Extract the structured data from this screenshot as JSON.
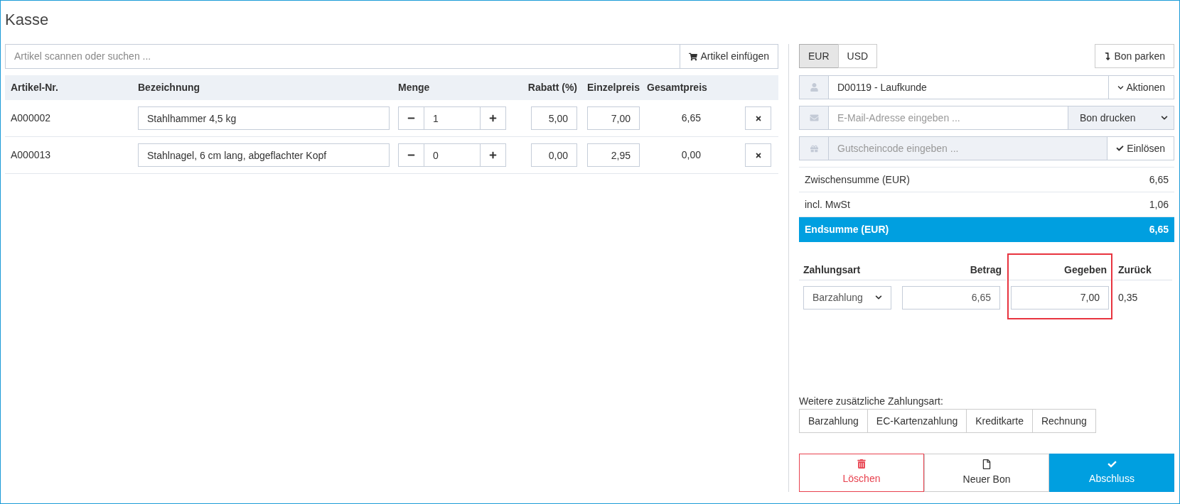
{
  "title": "Kasse",
  "search": {
    "placeholder": "Artikel scannen oder suchen ...",
    "button": "Artikel einfügen"
  },
  "table": {
    "columns": [
      "Artikel-Nr.",
      "Bezeichnung",
      "Menge",
      "Rabatt (%)",
      "Einzelpreis",
      "Gesamtpreis"
    ],
    "rows": [
      {
        "article_no": "A000002",
        "name": "Stahlhammer 4,5 kg",
        "quantity": "1",
        "discount": "5,00",
        "unit_price": "7,00",
        "total": "6,65"
      },
      {
        "article_no": "A000013",
        "name": "Stahlnagel, 6 cm lang, abgeflachter Kopf",
        "quantity": "0",
        "discount": "0,00",
        "unit_price": "2,95",
        "total": "0,00"
      }
    ]
  },
  "currencies": [
    {
      "label": "EUR",
      "selected": true
    },
    {
      "label": "USD",
      "selected": false
    }
  ],
  "park_button": "Bon parken",
  "customer": {
    "value": "D00119 - Laufkunde",
    "actions": "Aktionen"
  },
  "email": {
    "placeholder": "E-Mail-Adresse eingeben ...",
    "select": "Bon drucken"
  },
  "voucher": {
    "placeholder": "Gutscheincode eingeben ...",
    "button": "Einlösen"
  },
  "totals": [
    {
      "label": "Zwischensumme (EUR)",
      "value": "6,65",
      "kind": "normal"
    },
    {
      "label": "incl. MwSt",
      "value": "1,06",
      "kind": "normal"
    },
    {
      "label": "Endsumme (EUR)",
      "value": "6,65",
      "kind": "grand"
    }
  ],
  "payment": {
    "columns": [
      {
        "label": "Zahlungsart",
        "highlighted": false
      },
      {
        "label": "Betrag",
        "highlighted": false
      },
      {
        "label": "Gegeben",
        "highlighted": true
      },
      {
        "label": "Zurück",
        "highlighted": false
      }
    ],
    "row": {
      "method": "Barzahlung",
      "amount": "6,65",
      "given": "7,00",
      "change": "0,35"
    }
  },
  "additional": {
    "label": "Weitere zusätzliche Zahlungsart:",
    "options": [
      "Barzahlung",
      "EC-Kartenzahlung",
      "Kreditkarte",
      "Rechnung"
    ]
  },
  "actions": [
    {
      "label": "Löschen",
      "kind": "delete"
    },
    {
      "label": "Neuer Bon",
      "kind": "new"
    },
    {
      "label": "Abschluss",
      "kind": "finish"
    }
  ]
}
